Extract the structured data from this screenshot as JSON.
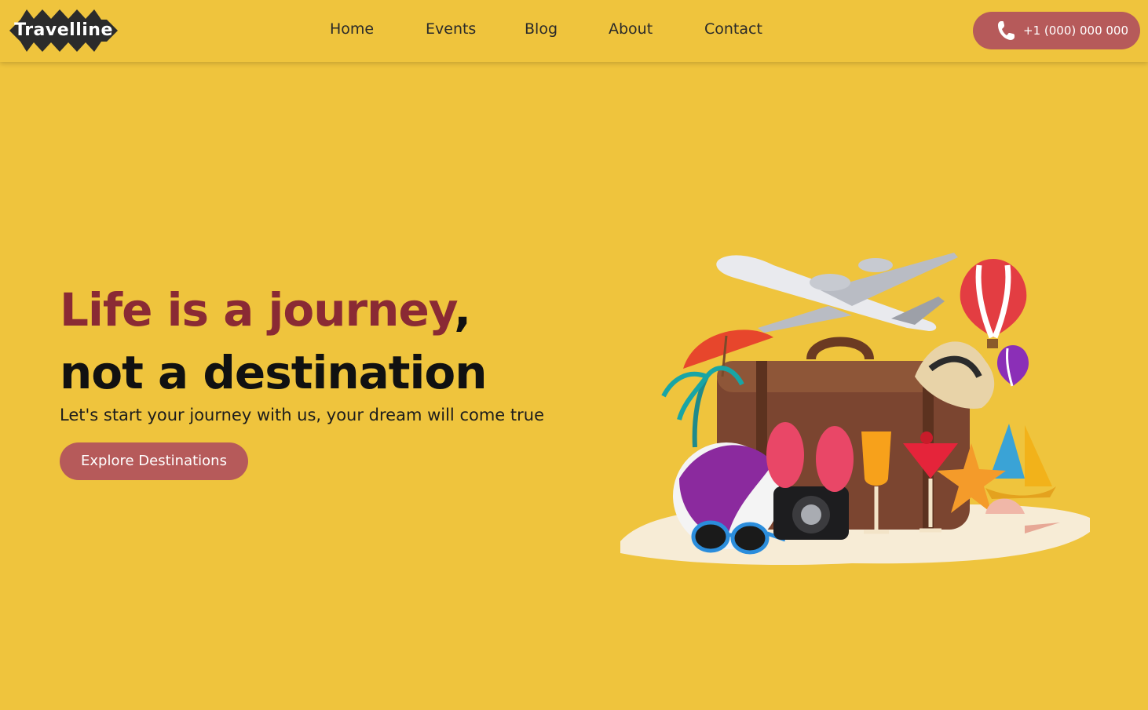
{
  "brand": {
    "name": "Travelline"
  },
  "nav": {
    "items": [
      {
        "label": "Home"
      },
      {
        "label": "Events"
      },
      {
        "label": "Blog"
      },
      {
        "label": "About"
      },
      {
        "label": "Contact"
      }
    ],
    "phone": {
      "label": "+1 (000) 000 000",
      "icon": "phone-icon"
    }
  },
  "hero": {
    "headline_accent": "Life is a journey",
    "headline_comma": ",",
    "headline_line2": "not a destination",
    "subtitle": "Let's start your journey with us, your dream will come true",
    "cta_label": "Explore Destinations"
  },
  "colors": {
    "background": "#efc43d",
    "accent": "#8a2a34",
    "button": "#b65a5a",
    "text_dark": "#111111"
  }
}
